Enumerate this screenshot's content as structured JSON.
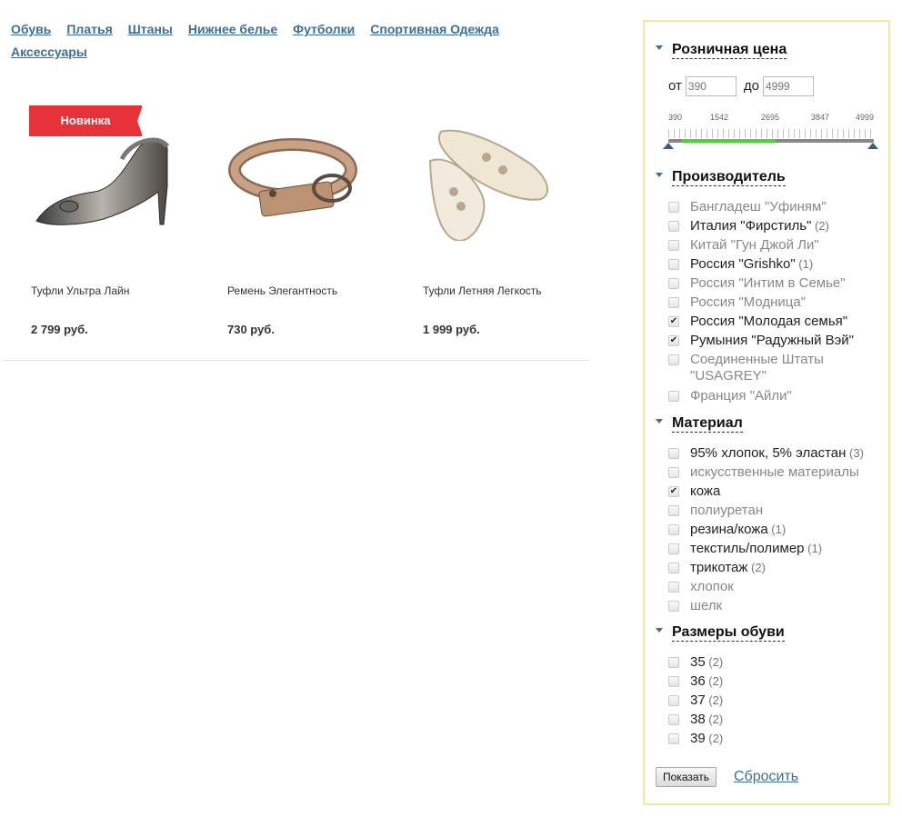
{
  "nav": [
    "Обувь",
    "Платья",
    "Штаны",
    "Нижнее белье",
    "Футболки",
    "Спортивная Одежда",
    "Аксессуары"
  ],
  "badge": "Новинка",
  "products": [
    {
      "title": "Туфли Ультра Лайн",
      "price": "2 799 руб.",
      "icon": "heeled-sandal-image"
    },
    {
      "title": "Ремень Элегантность",
      "price": "730 руб.",
      "icon": "belt-image"
    },
    {
      "title": "Туфли Летняя Легкость",
      "price": "1 999 руб.",
      "icon": "summer-shoes-image"
    }
  ],
  "filter": {
    "price": {
      "head": "Розничная цена",
      "from_label": "от",
      "to_label": "до",
      "from_placeholder": "390",
      "to_placeholder": "4999",
      "scale": [
        "390",
        "1542",
        "2695",
        "3847",
        "4999"
      ],
      "range_fill": [
        0.06,
        0.52
      ],
      "accent": "#4fcf3a"
    },
    "maker": {
      "head": "Производитель",
      "items": [
        {
          "label": "Бангладеш \"Уфиням\"",
          "count": "",
          "checked": false,
          "dim": true
        },
        {
          "label": "Италия \"Фирстиль\"",
          "count": "(2)",
          "checked": false,
          "dim": false
        },
        {
          "label": "Китай \"Гун Джой Ли\"",
          "count": "",
          "checked": false,
          "dim": true
        },
        {
          "label": "Россия \"Grishko\"",
          "count": "(1)",
          "checked": false,
          "dim": false
        },
        {
          "label": "Россия \"Интим в Семье\"",
          "count": "",
          "checked": false,
          "dim": true
        },
        {
          "label": "Россия \"Модница\"",
          "count": "",
          "checked": false,
          "dim": true
        },
        {
          "label": "Россия \"Молодая семья\"",
          "count": "",
          "checked": true,
          "dim": false
        },
        {
          "label": "Румыния \"Радужный Вэй\"",
          "count": "",
          "checked": true,
          "dim": false
        },
        {
          "label": "Соединенные Штаты \"USAGREY\"",
          "count": "",
          "checked": false,
          "dim": true
        },
        {
          "label": "Франция \"Айли\"",
          "count": "",
          "checked": false,
          "dim": true
        }
      ]
    },
    "material": {
      "head": "Материал",
      "items": [
        {
          "label": "95% хлопок, 5% эластан",
          "count": "(3)",
          "checked": false,
          "dim": false
        },
        {
          "label": "искусственные материалы",
          "count": "",
          "checked": false,
          "dim": true
        },
        {
          "label": "кожа",
          "count": "",
          "checked": true,
          "dim": false
        },
        {
          "label": "полиуретан",
          "count": "",
          "checked": false,
          "dim": true
        },
        {
          "label": "резина/кожа",
          "count": "(1)",
          "checked": false,
          "dim": false
        },
        {
          "label": "текстиль/полимер",
          "count": "(1)",
          "checked": false,
          "dim": false
        },
        {
          "label": "трикотаж",
          "count": "(2)",
          "checked": false,
          "dim": false
        },
        {
          "label": "хлопок",
          "count": "",
          "checked": false,
          "dim": true
        },
        {
          "label": "шелк",
          "count": "",
          "checked": false,
          "dim": true
        }
      ]
    },
    "sizes": {
      "head": "Размеры обуви",
      "items": [
        {
          "label": "35",
          "count": "(2)",
          "checked": false,
          "dim": false
        },
        {
          "label": "36",
          "count": "(2)",
          "checked": false,
          "dim": false
        },
        {
          "label": "37",
          "count": "(2)",
          "checked": false,
          "dim": false
        },
        {
          "label": "38",
          "count": "(2)",
          "checked": false,
          "dim": false
        },
        {
          "label": "39",
          "count": "(2)",
          "checked": false,
          "dim": false
        }
      ]
    },
    "show_label": "Показать",
    "reset_label": "Сбросить"
  }
}
